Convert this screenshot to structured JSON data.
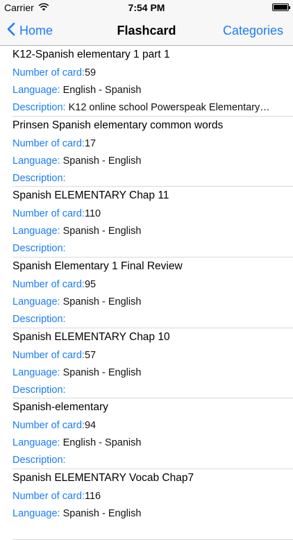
{
  "status_bar": {
    "carrier": "Carrier",
    "time": "7:54 PM"
  },
  "nav": {
    "back_label": "Home",
    "title": "Flashcard",
    "right_label": "Categories"
  },
  "labels": {
    "number": "Number of card:",
    "language": "Language:",
    "description": "Description:"
  },
  "cards": [
    {
      "title": "K12-Spanish elementary 1 part 1",
      "count": "59",
      "language": "English - Spanish",
      "description": "K12 online school Powerspeak Elementary…"
    },
    {
      "title": "Prinsen Spanish elementary common words",
      "count": "17",
      "language": "Spanish - English",
      "description": ""
    },
    {
      "title": "Spanish ELEMENTARY Chap 11",
      "count": "110",
      "language": "Spanish - English",
      "description": ""
    },
    {
      "title": "Spanish Elementary 1 Final Review",
      "count": "95",
      "language": "Spanish - English",
      "description": ""
    },
    {
      "title": "Spanish ELEMENTARY Chap 10",
      "count": "57",
      "language": "Spanish - English",
      "description": ""
    },
    {
      "title": "Spanish-elementary",
      "count": "94",
      "language": "English - Spanish",
      "description": ""
    },
    {
      "title": "Spanish ELEMENTARY Vocab Chap7",
      "count": "116",
      "language": "Spanish - English",
      "description": ""
    }
  ]
}
